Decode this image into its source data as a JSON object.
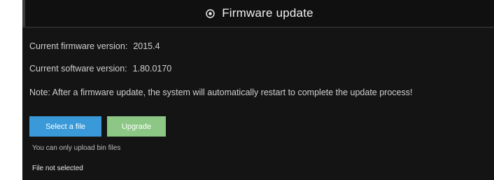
{
  "header": {
    "title": "Firmware update",
    "icon": "radio-circle-icon"
  },
  "info": {
    "firmware_label": "Current firmware version:",
    "firmware_value": "2015.4",
    "software_label": "Current software version:",
    "software_value": "1.80.0170"
  },
  "note": "Note: After a firmware update, the system will automatically restart to complete the update process!",
  "buttons": {
    "select_label": "Select a file",
    "upgrade_label": "Upgrade"
  },
  "hint": "You can only upload bin files",
  "file_status": "File not selected",
  "colors": {
    "background": "#141414",
    "select_button": "#3a9ad9",
    "upgrade_button": "#8cc785",
    "text": "#cfcfcf"
  }
}
